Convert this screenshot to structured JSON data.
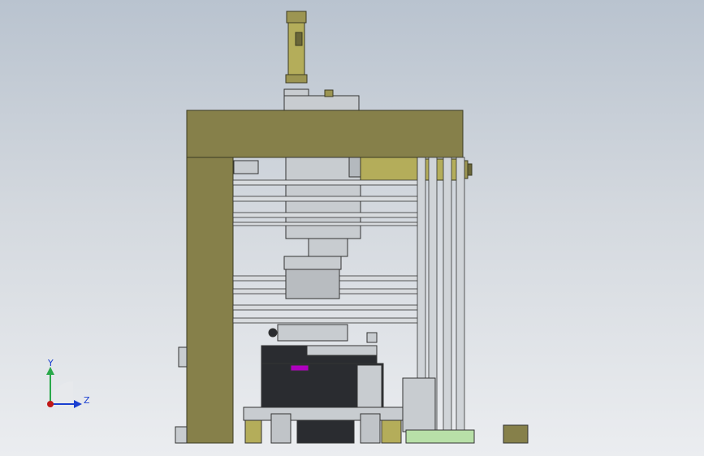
{
  "viewport": {
    "background_top": "#b9c3cf",
    "background_bottom": "#ebedf0"
  },
  "model": {
    "frame_color": "#86804a",
    "frame_edge": "#3b3a22",
    "metal_color": "#c8ccd0",
    "dark_part_color": "#2a2c30",
    "accent_part_color": "#b000c0",
    "cylinder_color": "#b4ad5a"
  },
  "triad": {
    "y_label": "Y",
    "z_label": "Z",
    "y_color": "#2aa84a",
    "z_color": "#1a3fd0",
    "origin_color": "#c01818"
  }
}
